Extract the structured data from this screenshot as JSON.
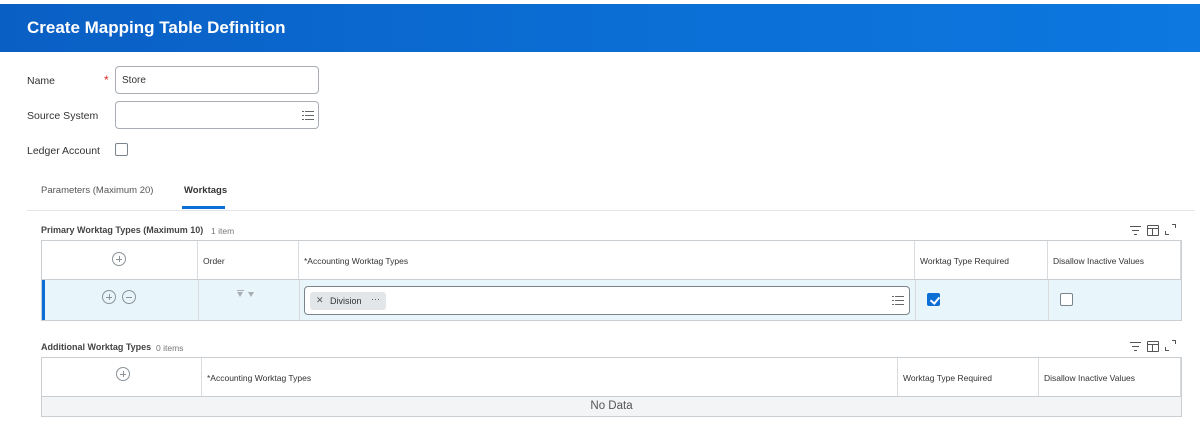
{
  "header": {
    "title": "Create Mapping Table Definition"
  },
  "form": {
    "name_label": "Name",
    "name_required": "*",
    "name_value": "Store",
    "source_system_label": "Source System",
    "source_system_value": "",
    "ledger_account_label": "Ledger Account",
    "ledger_account_checked": false,
    "source_system_icon": "list-icon"
  },
  "tabs": [
    {
      "label": "Parameters (Maximum 20)",
      "active": false
    },
    {
      "label": "Worktags",
      "active": true
    }
  ],
  "primary": {
    "title": "Primary Worktag Types (Maximum 10)",
    "count": "1 item",
    "columns": [
      "Order",
      "*Accounting Worktag Types",
      "Worktag Type Required",
      "Disallow Inactive Values"
    ],
    "rows": [
      {
        "worktags": [
          {
            "label": "Division",
            "more": "⋯"
          }
        ],
        "worktag_type_required": true,
        "disallow_inactive_values": false
      }
    ],
    "toolbar_icons": [
      "filter-icon",
      "columns-icon",
      "expand-icon"
    ]
  },
  "additional": {
    "title": "Additional Worktag Types",
    "count": "0 items",
    "columns": [
      "*Accounting Worktag Types",
      "Worktag Type Required",
      "Disallow Inactive Values"
    ],
    "empty_text": "No Data",
    "toolbar_icons": [
      "filter-icon",
      "columns-icon",
      "expand-icon"
    ]
  },
  "colors": {
    "brand_blue": "#0b6fd6",
    "row_highlight": "#e8f6fb",
    "required_red": "#de2b2b"
  }
}
